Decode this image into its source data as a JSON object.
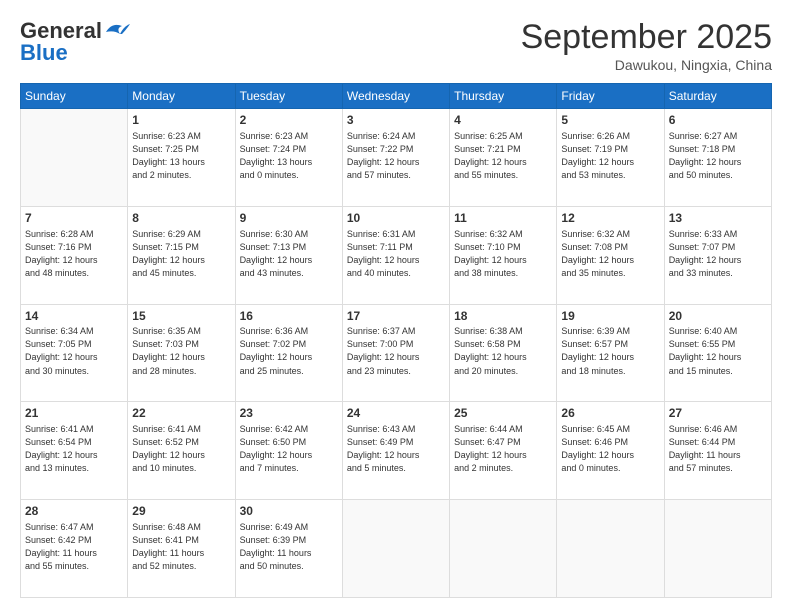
{
  "header": {
    "logo_line1": "General",
    "logo_line2": "Blue",
    "month": "September 2025",
    "location": "Dawukou, Ningxia, China"
  },
  "weekdays": [
    "Sunday",
    "Monday",
    "Tuesday",
    "Wednesday",
    "Thursday",
    "Friday",
    "Saturday"
  ],
  "weeks": [
    [
      {
        "day": "",
        "info": ""
      },
      {
        "day": "1",
        "info": "Sunrise: 6:23 AM\nSunset: 7:25 PM\nDaylight: 13 hours\nand 2 minutes."
      },
      {
        "day": "2",
        "info": "Sunrise: 6:23 AM\nSunset: 7:24 PM\nDaylight: 13 hours\nand 0 minutes."
      },
      {
        "day": "3",
        "info": "Sunrise: 6:24 AM\nSunset: 7:22 PM\nDaylight: 12 hours\nand 57 minutes."
      },
      {
        "day": "4",
        "info": "Sunrise: 6:25 AM\nSunset: 7:21 PM\nDaylight: 12 hours\nand 55 minutes."
      },
      {
        "day": "5",
        "info": "Sunrise: 6:26 AM\nSunset: 7:19 PM\nDaylight: 12 hours\nand 53 minutes."
      },
      {
        "day": "6",
        "info": "Sunrise: 6:27 AM\nSunset: 7:18 PM\nDaylight: 12 hours\nand 50 minutes."
      }
    ],
    [
      {
        "day": "7",
        "info": "Sunrise: 6:28 AM\nSunset: 7:16 PM\nDaylight: 12 hours\nand 48 minutes."
      },
      {
        "day": "8",
        "info": "Sunrise: 6:29 AM\nSunset: 7:15 PM\nDaylight: 12 hours\nand 45 minutes."
      },
      {
        "day": "9",
        "info": "Sunrise: 6:30 AM\nSunset: 7:13 PM\nDaylight: 12 hours\nand 43 minutes."
      },
      {
        "day": "10",
        "info": "Sunrise: 6:31 AM\nSunset: 7:11 PM\nDaylight: 12 hours\nand 40 minutes."
      },
      {
        "day": "11",
        "info": "Sunrise: 6:32 AM\nSunset: 7:10 PM\nDaylight: 12 hours\nand 38 minutes."
      },
      {
        "day": "12",
        "info": "Sunrise: 6:32 AM\nSunset: 7:08 PM\nDaylight: 12 hours\nand 35 minutes."
      },
      {
        "day": "13",
        "info": "Sunrise: 6:33 AM\nSunset: 7:07 PM\nDaylight: 12 hours\nand 33 minutes."
      }
    ],
    [
      {
        "day": "14",
        "info": "Sunrise: 6:34 AM\nSunset: 7:05 PM\nDaylight: 12 hours\nand 30 minutes."
      },
      {
        "day": "15",
        "info": "Sunrise: 6:35 AM\nSunset: 7:03 PM\nDaylight: 12 hours\nand 28 minutes."
      },
      {
        "day": "16",
        "info": "Sunrise: 6:36 AM\nSunset: 7:02 PM\nDaylight: 12 hours\nand 25 minutes."
      },
      {
        "day": "17",
        "info": "Sunrise: 6:37 AM\nSunset: 7:00 PM\nDaylight: 12 hours\nand 23 minutes."
      },
      {
        "day": "18",
        "info": "Sunrise: 6:38 AM\nSunset: 6:58 PM\nDaylight: 12 hours\nand 20 minutes."
      },
      {
        "day": "19",
        "info": "Sunrise: 6:39 AM\nSunset: 6:57 PM\nDaylight: 12 hours\nand 18 minutes."
      },
      {
        "day": "20",
        "info": "Sunrise: 6:40 AM\nSunset: 6:55 PM\nDaylight: 12 hours\nand 15 minutes."
      }
    ],
    [
      {
        "day": "21",
        "info": "Sunrise: 6:41 AM\nSunset: 6:54 PM\nDaylight: 12 hours\nand 13 minutes."
      },
      {
        "day": "22",
        "info": "Sunrise: 6:41 AM\nSunset: 6:52 PM\nDaylight: 12 hours\nand 10 minutes."
      },
      {
        "day": "23",
        "info": "Sunrise: 6:42 AM\nSunset: 6:50 PM\nDaylight: 12 hours\nand 7 minutes."
      },
      {
        "day": "24",
        "info": "Sunrise: 6:43 AM\nSunset: 6:49 PM\nDaylight: 12 hours\nand 5 minutes."
      },
      {
        "day": "25",
        "info": "Sunrise: 6:44 AM\nSunset: 6:47 PM\nDaylight: 12 hours\nand 2 minutes."
      },
      {
        "day": "26",
        "info": "Sunrise: 6:45 AM\nSunset: 6:46 PM\nDaylight: 12 hours\nand 0 minutes."
      },
      {
        "day": "27",
        "info": "Sunrise: 6:46 AM\nSunset: 6:44 PM\nDaylight: 11 hours\nand 57 minutes."
      }
    ],
    [
      {
        "day": "28",
        "info": "Sunrise: 6:47 AM\nSunset: 6:42 PM\nDaylight: 11 hours\nand 55 minutes."
      },
      {
        "day": "29",
        "info": "Sunrise: 6:48 AM\nSunset: 6:41 PM\nDaylight: 11 hours\nand 52 minutes."
      },
      {
        "day": "30",
        "info": "Sunrise: 6:49 AM\nSunset: 6:39 PM\nDaylight: 11 hours\nand 50 minutes."
      },
      {
        "day": "",
        "info": ""
      },
      {
        "day": "",
        "info": ""
      },
      {
        "day": "",
        "info": ""
      },
      {
        "day": "",
        "info": ""
      }
    ]
  ]
}
